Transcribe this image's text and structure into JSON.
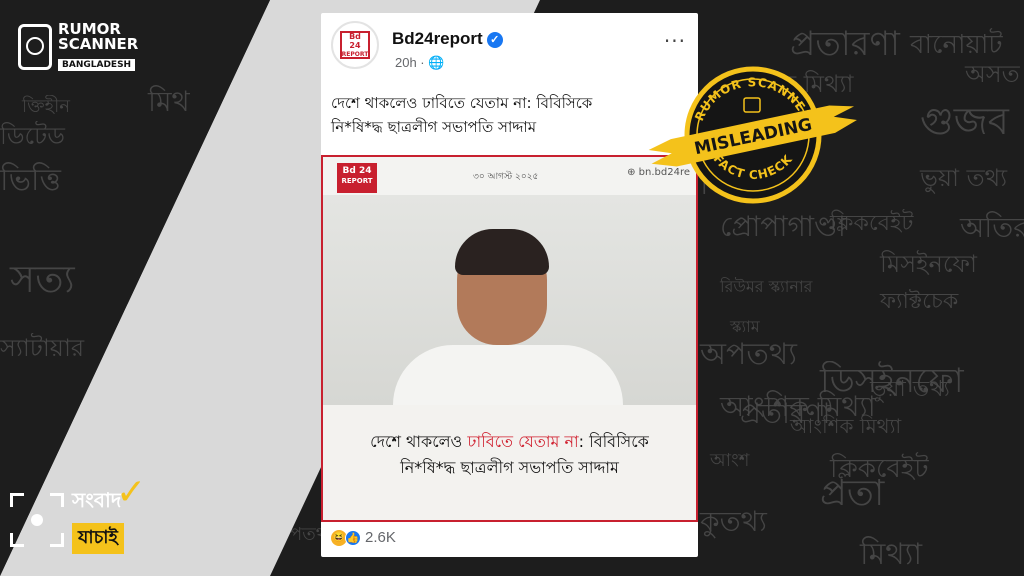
{
  "brand": {
    "rumor_scanner": {
      "line1": "RUMOR",
      "line2": "SCANNER",
      "badge": "BANGLADESH"
    },
    "sangbad": {
      "line1": "সংবাদ",
      "line2": "যাচাই"
    }
  },
  "background_words": [
    "প্রতারণা",
    "বানোয়াট",
    "অসত",
    "আংশিক মিথ্যা",
    "গুজব",
    "মিথ",
    "সত্য",
    "ভিত্তি",
    "মিথ্যা",
    "ভুয়া তথ্য",
    "প্রোপাগাণ্ডা",
    "ক্লিকবেইট",
    "অতিরঞ্জিত",
    "মিসইনফো",
    "রিউমর স্ক্যানার",
    "ফ্যাক্টচেক",
    "স্ক্যাম",
    "সত্য",
    "স্যাটায়ার",
    "অপতথ্য",
    "ডিসইনফো",
    "প্রতারণা",
    "ভুয়া তথ্য",
    "আংশিক মিথ্যা",
    "ক্লিকবেইট",
    "আংশ",
    "প্রতা",
    "কুতথ্য",
    "মিথ্যা",
    "ক্তিহীন",
    "ডিটেড",
    "আংশিক মিথ্যা",
    "পতথ্য"
  ],
  "post": {
    "page_name": "Bd24report",
    "time": "20h · 🌐",
    "more": "···",
    "caption_line1": "দেশে থাকলেও ঢাবিতে যেতাম না: বিবিসিকে",
    "caption_line2": "নি*ষি*দ্ধ ছাত্রলীগ সভাপতি সাদ্দাম",
    "avatar_text1": "Bd",
    "avatar_text2": "24",
    "avatar_text3": "REPORT"
  },
  "media": {
    "logo_l1": "Bd 24",
    "logo_l2": "REPORT",
    "date": "৩০ আগস্ট ২০২৫",
    "site": "⊕ bn.bd24re",
    "overlay_pre": "দেশে থাকলেও ",
    "overlay_red": "ঢাবিতে যেতাম না",
    "overlay_post": ": বিবিসিকে",
    "overlay_line2": "নি*ষি*দ্ধ ছাত্রলীগ সভাপতি সাদ্দাম"
  },
  "reactions": {
    "haha": "😆",
    "like": "👍",
    "count": "2.6K"
  },
  "stamp": {
    "top": "RUMOR SCANNER",
    "label": "MISLEADING",
    "bottom": "FACT CHECK",
    "colors": {
      "yellow": "#f4c21b",
      "dark": "#151515"
    }
  }
}
